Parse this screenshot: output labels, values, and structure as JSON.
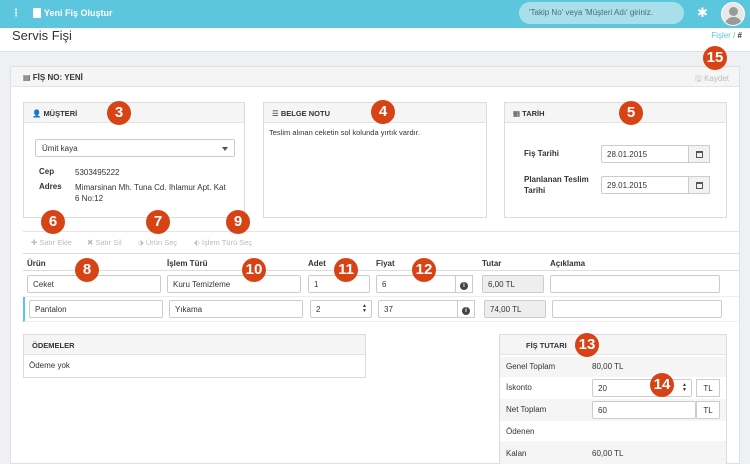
{
  "topbar": {
    "title": "Yeni Fiş Oluştur",
    "search_placeholder": "'Takip No' veya 'Müşteri Adı' giriniz."
  },
  "page": {
    "title": "Servis Fişi",
    "breadcrumb": {
      "link": "Fişler",
      "sep": "/",
      "current": "#"
    }
  },
  "fis": {
    "label": "FİŞ NO: YENİ",
    "save_label": "Kaydet"
  },
  "musteri": {
    "header": "MÜŞTERİ",
    "selected": "Ümit kaya",
    "cep_label": "Cep",
    "cep_value": "5303495222",
    "adres_label": "Adres",
    "adres_value": "Mimarsinan Mh. Tuna Cd. Ihlamur Apt. Kat 6 No:12"
  },
  "belge_notu": {
    "header": "BELGE NOTU",
    "text": "Teslim alınan ceketin sol kolunda yırtık vardır."
  },
  "tarih": {
    "header": "TARİH",
    "fis_tarihi_label": "Fiş Tarihi",
    "fis_tarihi_value": "28.01.2015",
    "planlanan_label_1": "Planlanan Teslim",
    "planlanan_label_2": "Tarihi",
    "planlanan_value": "29.01.2015"
  },
  "toolbar": {
    "satir_ekle": "Satır Ekle",
    "satir_sil": "Satır Sil",
    "urun_sec": "Ürün Seç",
    "islem_turu_sec": "İşlem Türü Seç"
  },
  "table": {
    "headers": {
      "urun": "Ürün",
      "islem": "İşlem Türü",
      "adet": "Adet",
      "fiyat": "Fiyat",
      "tutar": "Tutar",
      "aciklama": "Açıklama"
    },
    "rows": [
      {
        "urun": "Ceket",
        "islem": "Kuru Temizleme",
        "adet": "1",
        "fiyat": "6",
        "tutar": "6,00 TL",
        "aciklama": ""
      },
      {
        "urun": "Pantalon",
        "islem": "Yıkama",
        "adet": "2",
        "fiyat": "37",
        "tutar": "74,00 TL",
        "aciklama": ""
      }
    ]
  },
  "odemeler": {
    "header": "ÖDEMELER",
    "empty": "Ödeme yok"
  },
  "fis_tutari": {
    "header": "FİŞ TUTARI",
    "genel_label": "Genel Toplam",
    "genel_value": "80,00 TL",
    "iskonto_label": "İskonto",
    "iskonto_value": "20",
    "iskonto_unit": "TL",
    "net_label": "Net Toplam",
    "net_value": "60",
    "net_unit": "TL",
    "odenen_label": "Ödenen",
    "kalan_label": "Kalan",
    "kalan_value": "60,00 TL"
  },
  "badges": [
    "3",
    "4",
    "5",
    "6",
    "7",
    "8",
    "9",
    "10",
    "11",
    "12",
    "13",
    "14",
    "15"
  ]
}
